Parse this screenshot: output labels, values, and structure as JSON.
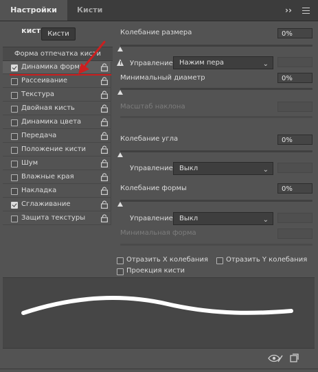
{
  "tabs": [
    "Настройки кисти",
    "Кисти"
  ],
  "brushes_button": "Кисти",
  "tip_shape_header": "Форма отпечатка кисти",
  "options": [
    {
      "label": "Динамика формы",
      "checked": true,
      "selected": true
    },
    {
      "label": "Рассеивание",
      "checked": false
    },
    {
      "label": "Текстура",
      "checked": false
    },
    {
      "label": "Двойная кисть",
      "checked": false
    },
    {
      "label": "Динамика цвета",
      "checked": false
    },
    {
      "label": "Передача",
      "checked": false
    },
    {
      "label": "Положение кисти",
      "checked": false
    },
    {
      "label": "Шум",
      "checked": false
    },
    {
      "label": "Влажные края",
      "checked": false
    },
    {
      "label": "Накладка",
      "checked": false
    },
    {
      "label": "Сглаживание",
      "checked": true
    },
    {
      "label": "Защита текстуры",
      "checked": false
    }
  ],
  "size_jitter": {
    "label": "Колебание размера",
    "value": "0%",
    "level": 0
  },
  "control_label": "Управление:",
  "size_control": {
    "value": "Нажим пера"
  },
  "min_diameter": {
    "label": "Минимальный диаметр",
    "value": "0%",
    "level": 0
  },
  "tilt_scale": {
    "label": "Масштаб наклона"
  },
  "angle_jitter": {
    "label": "Колебание угла",
    "value": "0%",
    "level": 0
  },
  "angle_control": {
    "value": "Выкл"
  },
  "roundness_jitter": {
    "label": "Колебание формы",
    "value": "0%",
    "level": 0
  },
  "roundness_control": {
    "value": "Выкл"
  },
  "min_roundness": {
    "label": "Минимальная форма"
  },
  "flip_x": "Отразить X колебания",
  "flip_y": "Отразить Y колебания",
  "brush_projection": "Проекция кисти",
  "colors": {
    "panel": "#535353",
    "tabbar": "#3c3c3c",
    "preview": "#464646",
    "arrow": "#cc1f1f",
    "stroke": "#ffffff"
  },
  "icons": {
    "menu": "menu-icon",
    "lock": "lock-icon",
    "warning": "warning-icon",
    "eye": "eye-brush-icon",
    "new": "new-brush-icon",
    "chevron": "chevron-down-icon",
    "expand": "double-chevron-icon"
  }
}
